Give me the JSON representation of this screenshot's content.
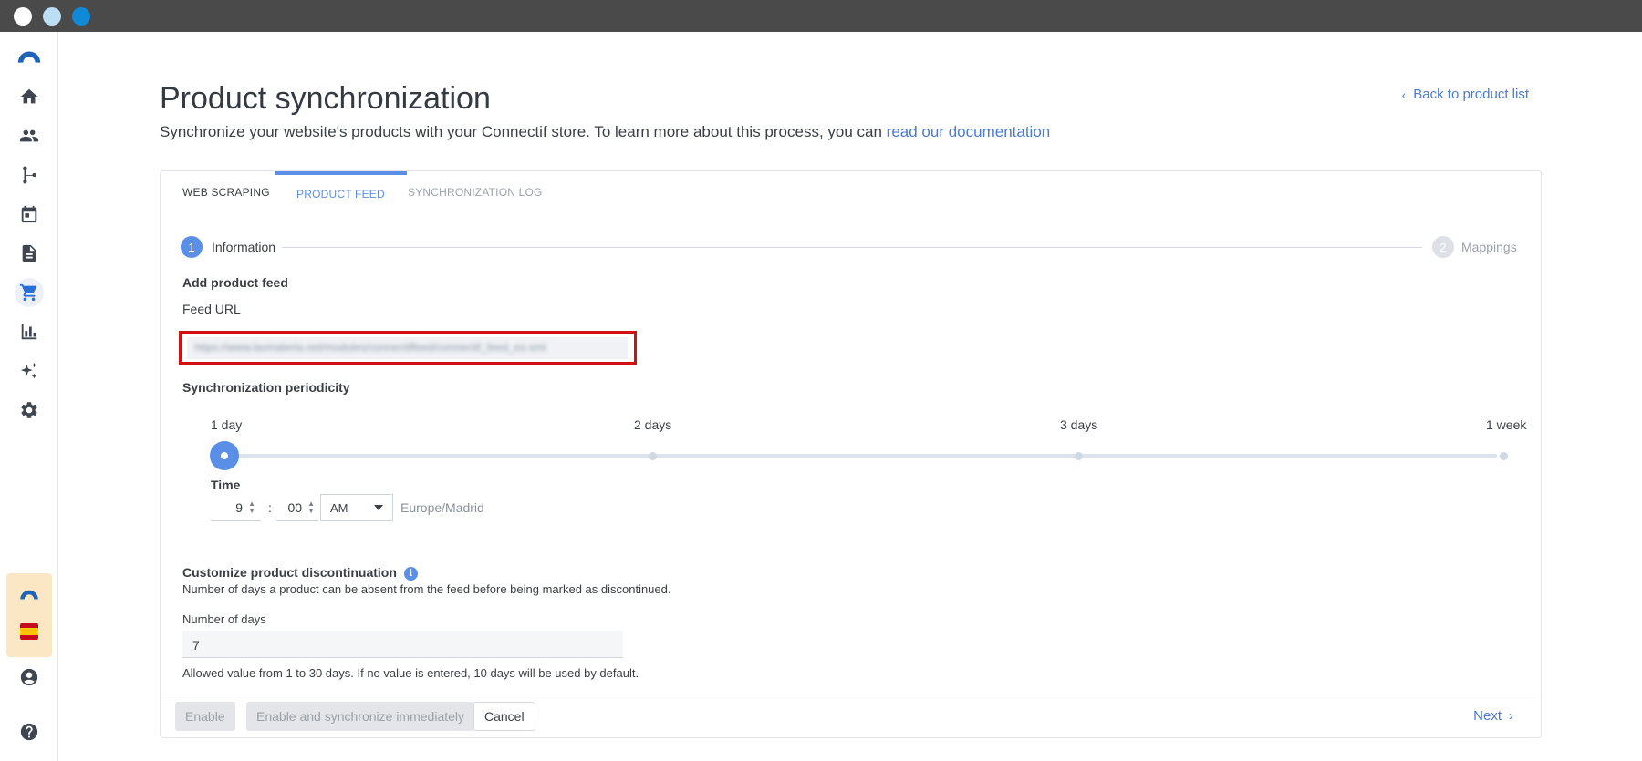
{
  "window": {
    "dot_colors": [
      "#ffffff",
      "#bcdff6",
      "#0f8ad8"
    ]
  },
  "sidebar": {
    "logo": "connectif-logo-icon",
    "items": [
      {
        "name": "home-icon"
      },
      {
        "name": "contacts-icon"
      },
      {
        "name": "workflows-icon"
      },
      {
        "name": "calendar-icon"
      },
      {
        "name": "content-icon"
      },
      {
        "name": "cart-icon",
        "active": true
      },
      {
        "name": "analytics-icon"
      },
      {
        "name": "ai-sparkle-icon"
      },
      {
        "name": "settings-icon"
      }
    ],
    "bottom": [
      "account-icon",
      "help-icon"
    ]
  },
  "header": {
    "title": "Product synchronization",
    "back_label": "Back to product list",
    "subtitle_text": "Synchronize your website's products with your Connectif store. To learn more about this process, you can ",
    "subtitle_link": "read our documentation"
  },
  "tabs": [
    {
      "label": "WEB SCRAPING",
      "state": "normal"
    },
    {
      "label": "PRODUCT FEED",
      "state": "active"
    },
    {
      "label": "SYNCHRONIZATION LOG",
      "state": "muted"
    }
  ],
  "stepper": {
    "step1": {
      "number": "1",
      "label": "Information"
    },
    "step2": {
      "number": "2",
      "label": "Mappings"
    }
  },
  "feed": {
    "section_title": "Add product feed",
    "url_label": "Feed URL",
    "url_value": "https://www.lavinateria.net/modules/connectiffeed/connectif_feed_es.xml"
  },
  "periodicity": {
    "section_title": "Synchronization periodicity",
    "options": [
      "1 day",
      "2 days",
      "3 days",
      "1 week"
    ],
    "selected": "1 day",
    "time_label": "Time",
    "hour": "9",
    "separator": ":",
    "minute": "00",
    "meridiem": "AM",
    "timezone": "Europe/Madrid"
  },
  "discontinuation": {
    "section_title": "Customize product discontinuation",
    "description": "Number of days a product can be absent from the feed before being marked as discontinued.",
    "days_label": "Number of days",
    "days_value": "7",
    "hint": "Allowed value from 1 to 30 days. If no value is entered, 10 days will be used by default."
  },
  "footer": {
    "enable_label": "Enable",
    "enable_sync_label": "Enable and synchronize immediately",
    "cancel_label": "Cancel",
    "next_label": "Next"
  },
  "colors": {
    "accent": "#5b8ee6",
    "link": "#4a7bd1",
    "highlight_border": "#d20f13"
  }
}
